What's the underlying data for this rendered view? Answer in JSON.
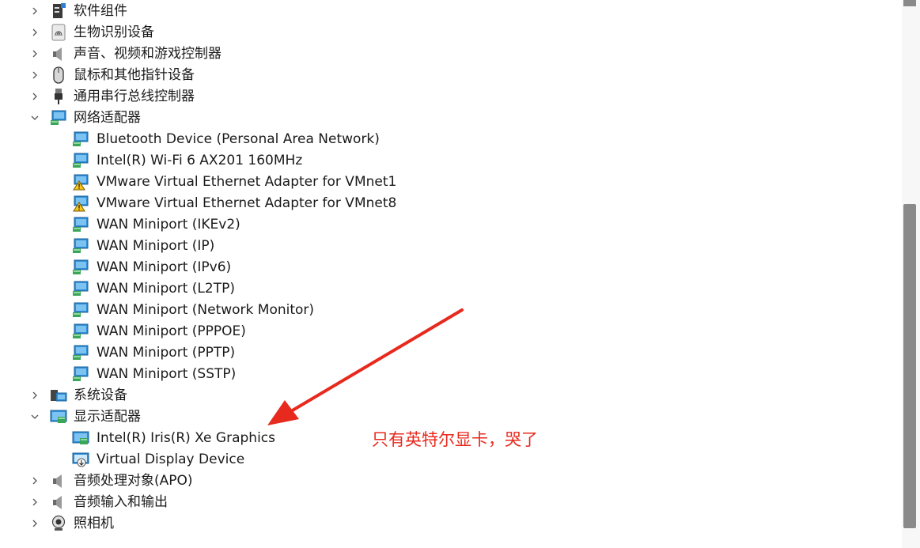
{
  "tree": {
    "categories_top": [
      {
        "label": "软件组件",
        "icon": "software-component-icon",
        "expanded": false
      },
      {
        "label": "生物识别设备",
        "icon": "fingerprint-icon",
        "expanded": false
      },
      {
        "label": "声音、视频和游戏控制器",
        "icon": "speaker-icon",
        "expanded": false
      },
      {
        "label": "鼠标和其他指针设备",
        "icon": "mouse-icon",
        "expanded": false
      },
      {
        "label": "通用串行总线控制器",
        "icon": "usb-icon",
        "expanded": false
      }
    ],
    "network": {
      "label": "网络适配器",
      "icon": "network-adapter-icon",
      "expanded": true,
      "devices": [
        {
          "label": "Bluetooth Device (Personal Area Network)",
          "icon": "network-adapter-icon"
        },
        {
          "label": "Intel(R) Wi-Fi 6 AX201 160MHz",
          "icon": "network-adapter-icon"
        },
        {
          "label": "VMware Virtual Ethernet Adapter for VMnet1",
          "icon": "network-adapter-warning-icon"
        },
        {
          "label": "VMware Virtual Ethernet Adapter for VMnet8",
          "icon": "network-adapter-warning-icon"
        },
        {
          "label": "WAN Miniport (IKEv2)",
          "icon": "network-adapter-icon"
        },
        {
          "label": "WAN Miniport (IP)",
          "icon": "network-adapter-icon"
        },
        {
          "label": "WAN Miniport (IPv6)",
          "icon": "network-adapter-icon"
        },
        {
          "label": "WAN Miniport (L2TP)",
          "icon": "network-adapter-icon"
        },
        {
          "label": "WAN Miniport (Network Monitor)",
          "icon": "network-adapter-icon"
        },
        {
          "label": "WAN Miniport (PPPOE)",
          "icon": "network-adapter-icon"
        },
        {
          "label": "WAN Miniport (PPTP)",
          "icon": "network-adapter-icon"
        },
        {
          "label": "WAN Miniport (SSTP)",
          "icon": "network-adapter-icon"
        }
      ]
    },
    "system": {
      "label": "系统设备",
      "icon": "system-device-icon",
      "expanded": false
    },
    "display": {
      "label": "显示适配器",
      "icon": "display-adapter-icon",
      "expanded": true,
      "devices": [
        {
          "label": "Intel(R) Iris(R) Xe Graphics",
          "icon": "display-adapter-icon"
        },
        {
          "label": "Virtual Display Device",
          "icon": "virtual-display-icon"
        }
      ]
    },
    "categories_bottom": [
      {
        "label": "音频处理对象(APO)",
        "icon": "speaker-icon",
        "expanded": false
      },
      {
        "label": "音频输入和输出",
        "icon": "speaker-icon",
        "expanded": false
      },
      {
        "label": "照相机",
        "icon": "camera-icon",
        "expanded": false
      }
    ]
  },
  "annotation": {
    "text": "只有英特尔显卡，哭了",
    "color": "#e8291d"
  }
}
